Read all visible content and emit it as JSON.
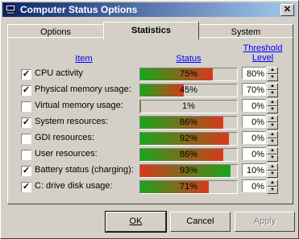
{
  "window": {
    "title": "Computer Status Options",
    "close_glyph": "✕"
  },
  "tabs": [
    {
      "label": "Options",
      "active": false
    },
    {
      "label": "Statistics",
      "active": true
    },
    {
      "label": "System",
      "active": false
    }
  ],
  "headers": {
    "item": "Item",
    "status": "Status",
    "threshold_line1": "Threshold",
    "threshold_line2": "Level"
  },
  "rows": [
    {
      "label": "CPU activity",
      "checked": true,
      "status": "75%",
      "status_value": 75,
      "threshold": "80%"
    },
    {
      "label": "Physical memory usage:",
      "checked": true,
      "status": "45%",
      "status_value": 45,
      "threshold": "70%"
    },
    {
      "label": "Virtual memory usage:",
      "checked": false,
      "status": "1%",
      "status_value": 1,
      "threshold": "0%"
    },
    {
      "label": "System resources:",
      "checked": true,
      "status": "86%",
      "status_value": 86,
      "threshold": "0%"
    },
    {
      "label": "GDI resources:",
      "checked": false,
      "status": "92%",
      "status_value": 92,
      "threshold": "0%"
    },
    {
      "label": "User resources:",
      "checked": false,
      "status": "86%",
      "status_value": 86,
      "threshold": "0%"
    },
    {
      "label": "Battery status (charging):",
      "checked": true,
      "status": "93%",
      "status_value": 93,
      "threshold": "10%",
      "reversed": true
    },
    {
      "label": "C: drive disk usage:",
      "checked": true,
      "status": "71%",
      "status_value": 71,
      "threshold": "0%"
    }
  ],
  "buttons": {
    "ok": "OK",
    "cancel": "Cancel",
    "apply": "Apply"
  },
  "colors": {
    "bar_start": "#1aa51a",
    "bar_end": "#d9381c",
    "title_start": "#0a246a",
    "title_end": "#a6caf0"
  }
}
